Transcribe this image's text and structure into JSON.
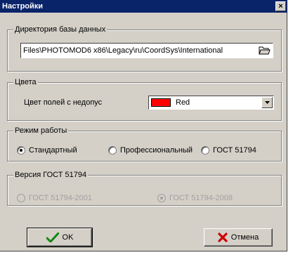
{
  "window": {
    "title": "Настройки",
    "close_label": "×"
  },
  "db_directory": {
    "legend": "Директория базы данных",
    "path": "Files\\PHOTOMOD6 x86\\Legacy\\ru\\CoordSys\\International"
  },
  "colors": {
    "legend": "Цвета",
    "field_label": "Цвет полей с недопус",
    "selected_color_name": "Red",
    "selected_color_hex": "#ff0000"
  },
  "mode": {
    "legend": "Режим работы",
    "options": [
      {
        "label": "Стандартный",
        "checked": true
      },
      {
        "label": "Профессиональный",
        "checked": false
      },
      {
        "label": "ГОСТ 51794",
        "checked": false
      }
    ]
  },
  "gost_version": {
    "legend": "Версия ГОСТ 51794",
    "options": [
      {
        "label": "ГОСТ 51794-2001",
        "checked": false
      },
      {
        "label": "ГОСТ 51794-2008",
        "checked": true
      }
    ]
  },
  "buttons": {
    "ok_label": "OK",
    "cancel_label": "Отмена"
  },
  "icons": {
    "ok": "checkmark-icon",
    "cancel": "cross-icon",
    "browse": "folder-open-icon",
    "dropdown": "chevron-down-icon"
  }
}
